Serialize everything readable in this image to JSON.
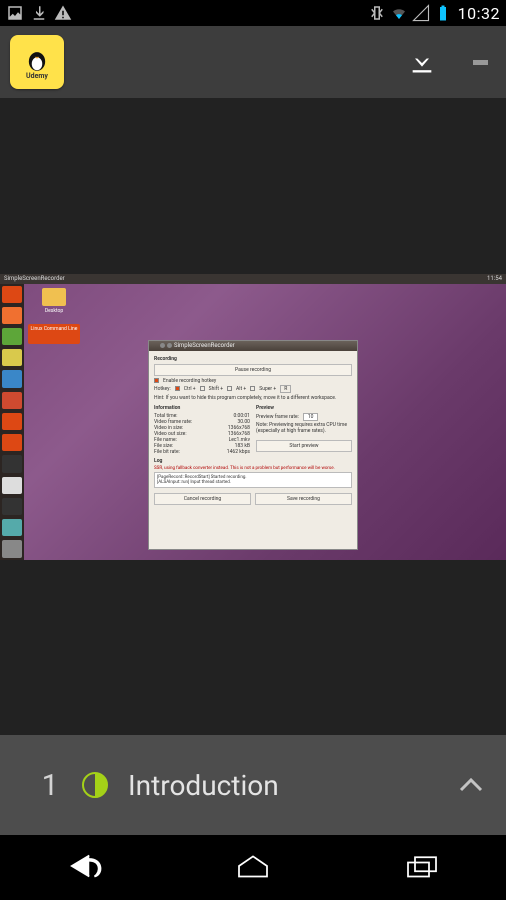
{
  "status": {
    "time": "10:32"
  },
  "actionbar": {
    "app_label": "Udemy"
  },
  "lesson": {
    "number": "1",
    "title": "Introduction"
  },
  "ubuntu": {
    "topbar_left": "SimpleScreenRecorder",
    "topbar_right": "11:54",
    "desktop_folder": "Desktop",
    "desktop_link": "Linux Command Line"
  },
  "launcher_colors": [
    "#dd4814",
    "#f07030",
    "#5da639",
    "#d9c94c",
    "#3a87c8",
    "#cf4a30",
    "#dd4814",
    "#dd4814",
    "#333",
    "#ddd",
    "#333",
    "#5aa",
    "#888"
  ],
  "ssr": {
    "title": "SimpleScreenRecorder",
    "section_recording": "Recording",
    "pause_btn": "Pause recording",
    "enable_hotkey": "Enable recording hotkey",
    "hotkey_label": "Hotkey:",
    "mod_ctrl": "Ctrl +",
    "mod_shift": "Shift +",
    "mod_alt": "Alt +",
    "mod_super": "Super +",
    "hotkey_key": "R",
    "hint": "Hint: If you want to hide this program completely, move it to a different workspace.",
    "section_info": "Information",
    "section_preview": "Preview",
    "info": {
      "total_time_l": "Total time:",
      "total_time_v": "0:00:01",
      "vfr_l": "Video frame rate:",
      "vfr_v": "30.00",
      "vis_l": "Video in size:",
      "vis_v": "1366x768",
      "vos_l": "Video out size:",
      "vos_v": "1366x768",
      "fname_l": "File name:",
      "fname_v": "Lec1.mkv",
      "fsize_l": "File size:",
      "fsize_v": "183 kB",
      "fbit_l": "File bit rate:",
      "fbit_v": "1462 kbps"
    },
    "preview_fr_l": "Preview frame rate:",
    "preview_fr_v": "10",
    "preview_note": "Note: Previewing requires extra CPU time (especially at high frame rates).",
    "start_preview": "Start preview",
    "section_log": "Log",
    "log_warn": "SSR, using fallback converter instead. This is not a problem but performance will be worse.",
    "log1": "[PageRecord::RecordStart] Started recording.",
    "log2": "[ALSAInput::run] Input thread started.",
    "cancel": "Cancel recording",
    "save": "Save recording"
  }
}
